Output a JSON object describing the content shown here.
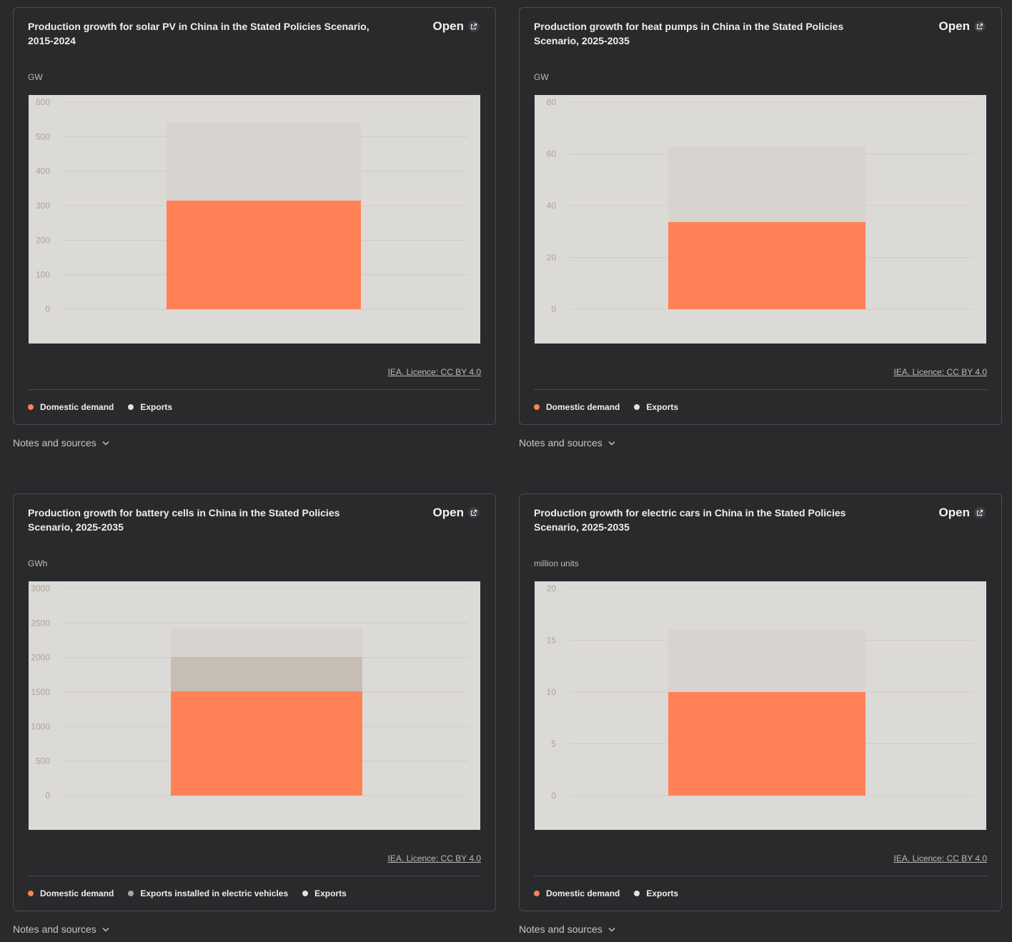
{
  "common": {
    "open_label": "Open",
    "licence": "IEA. Licence: CC BY 4.0",
    "notes_label": "Notes and sources",
    "colors": {
      "domestic": "#ff8155",
      "exports": "#d7d4cf",
      "exports_ev": "#c6bdb4",
      "plot_bg": "#dcdad7",
      "grid": "#cfccc8",
      "tick": "#a8a39d",
      "dot_exports_ev": "#a9a39d",
      "dot_exports": "#e3e0dc"
    }
  },
  "charts": [
    {
      "title": "Production growth for solar PV in China in the Stated Policies Scenario, 2015-2024",
      "unit": "GW",
      "legend": [
        {
          "label": "Domestic demand",
          "color": "#ff8155"
        },
        {
          "label": "Exports",
          "color": "#e3e0dc"
        }
      ]
    },
    {
      "title": "Production growth for heat pumps in China in the Stated Policies Scenario, 2025-2035",
      "unit": "GW",
      "legend": [
        {
          "label": "Domestic demand",
          "color": "#ff8155"
        },
        {
          "label": "Exports",
          "color": "#e3e0dc"
        }
      ]
    },
    {
      "title": "Production growth for battery cells in China in the Stated Policies Scenario, 2025-2035",
      "unit": "GWh",
      "legend": [
        {
          "label": "Domestic demand",
          "color": "#ff8155"
        },
        {
          "label": "Exports installed in electric vehicles",
          "color": "#a9a39d"
        },
        {
          "label": "Exports",
          "color": "#e3e0dc"
        }
      ]
    },
    {
      "title": "Production growth for electric cars in China in the Stated Policies Scenario, 2025-2035",
      "unit": "million units",
      "legend": [
        {
          "label": "Domestic demand",
          "color": "#ff8155"
        },
        {
          "label": "Exports",
          "color": "#e3e0dc"
        }
      ]
    }
  ],
  "chart_data": [
    {
      "type": "bar",
      "stacked": true,
      "title": "Production growth for solar PV in China in the Stated Policies Scenario, 2015-2024",
      "ylabel": "GW",
      "ylim": [
        0,
        600
      ],
      "yticks": [
        0,
        100,
        200,
        300,
        400,
        500,
        600
      ],
      "grid": true,
      "legend_position": "bottom",
      "series": [
        {
          "name": "Domestic demand",
          "values": [
            315
          ],
          "color": "#ff8155"
        },
        {
          "name": "Exports",
          "values": [
            225
          ],
          "color": "#d7d4cf"
        }
      ]
    },
    {
      "type": "bar",
      "stacked": true,
      "title": "Production growth for heat pumps in China in the Stated Policies Scenario, 2025-2035",
      "ylabel": "GW",
      "ylim": [
        0,
        80
      ],
      "yticks": [
        0,
        20,
        40,
        60,
        80
      ],
      "grid": true,
      "legend_position": "bottom",
      "series": [
        {
          "name": "Domestic demand",
          "values": [
            33.7
          ],
          "color": "#ff8155"
        },
        {
          "name": "Exports",
          "values": [
            29
          ],
          "color": "#d7d4cf"
        }
      ]
    },
    {
      "type": "bar",
      "stacked": true,
      "title": "Production growth for battery cells in China in the Stated Policies Scenario, 2025-2035",
      "ylabel": "GWh",
      "ylim": [
        0,
        3000
      ],
      "yticks": [
        0,
        500,
        1000,
        1500,
        2000,
        2500,
        3000
      ],
      "grid": true,
      "legend_position": "bottom",
      "series": [
        {
          "name": "Domestic demand",
          "values": [
            1510
          ],
          "color": "#ff8155"
        },
        {
          "name": "Exports installed in electric vehicles",
          "values": [
            500
          ],
          "color": "#c6bdb4"
        },
        {
          "name": "Exports",
          "values": [
            420
          ],
          "color": "#d7d4cf"
        }
      ]
    },
    {
      "type": "bar",
      "stacked": true,
      "title": "Production growth for electric cars in China in the Stated Policies Scenario, 2025-2035",
      "ylabel": "million units",
      "ylim": [
        0,
        20
      ],
      "yticks": [
        0,
        5,
        10,
        15,
        20
      ],
      "grid": true,
      "legend_position": "bottom",
      "series": [
        {
          "name": "Domestic demand",
          "values": [
            10
          ],
          "color": "#ff8155"
        },
        {
          "name": "Exports",
          "values": [
            6
          ],
          "color": "#d7d4cf"
        }
      ]
    }
  ]
}
